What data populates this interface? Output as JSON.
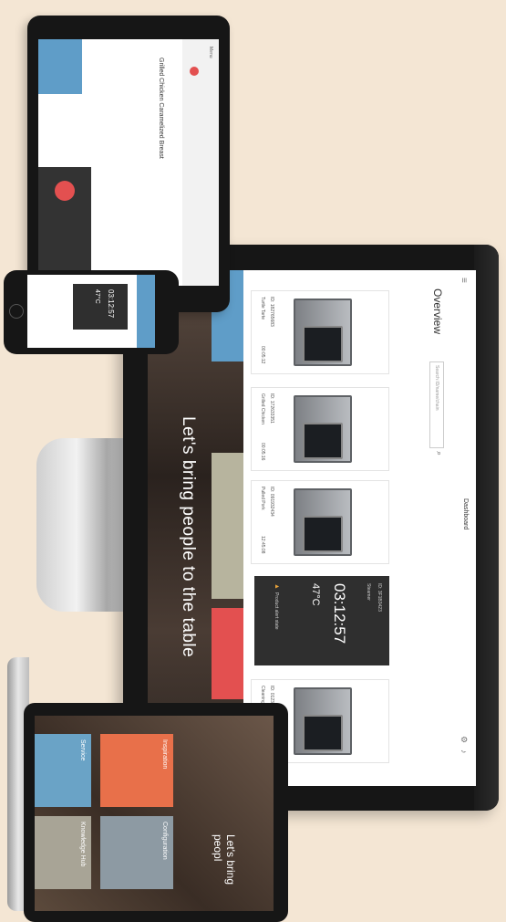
{
  "hero": {
    "tagline": "Let's bring people to the table"
  },
  "dashboard": {
    "nav_label": "Dashboard",
    "title": "Overview",
    "search_placeholder": "Search ID/name/chain",
    "cards": [
      {
        "id": "ID: 182765683",
        "name": "Turtle Tarte",
        "time": "00:05:12"
      },
      {
        "id": "ID: 172633351",
        "name": "Grilled Chicken",
        "time": "00:05:16"
      },
      {
        "id": "ID: 091932434",
        "name": "Pulled Pork",
        "time": "12:45:08"
      },
      {
        "id": "ID: 012322981",
        "name": "Cleaning",
        "time": ""
      }
    ],
    "alert_card": {
      "id": "ID: 3F1B3423",
      "status": "Steamer",
      "time": "03:12:57",
      "temp": "47°C",
      "warning": "Product alert state"
    }
  },
  "laptop": {
    "tagline": "Let's bring peopl",
    "tiles": [
      {
        "label": "Inspiration",
        "color": "#e8704a"
      },
      {
        "label": "Service",
        "color": "#6aa3c6"
      },
      {
        "label": "Configuration",
        "color": "#8d9aa3"
      },
      {
        "label": "Knowledge Hub",
        "color": "#a8a496"
      }
    ]
  },
  "phone": {
    "time": "03:12:57",
    "temp": "47°C"
  },
  "tablet": {
    "heading": "Grilled Chicken Caramelized Breast",
    "menu": "Menu"
  },
  "colors": {
    "accent_red": "#e35050",
    "tile_blue": "#5f9dc8",
    "tile_sand": "#b7b49e",
    "warning": "#e8a23a"
  }
}
